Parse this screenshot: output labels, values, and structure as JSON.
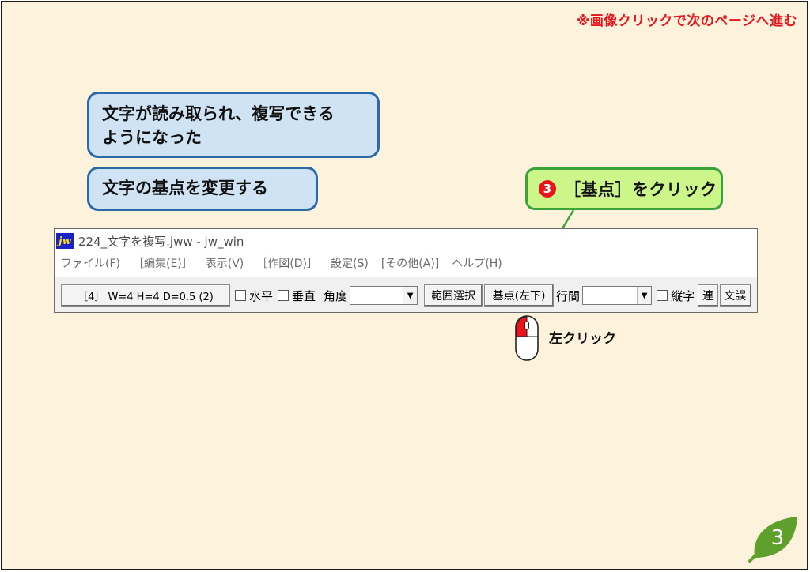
{
  "header": {
    "nav_hint": "※画像クリックで次のページへ進む"
  },
  "callouts": {
    "line1": "文字が読み取られ、複写できる",
    "line2": "ようになった",
    "sub": "文字の基点を変更する"
  },
  "step": {
    "number": "3",
    "label": "［基点］をクリック"
  },
  "window": {
    "title": "224_文字を複写.jww - jw_win",
    "menus": [
      "ファイル(F)",
      "［編集(E)］",
      "表示(V)",
      "［作図(D)］",
      "設定(S)",
      "[その他(A)]",
      "ヘルプ(H)"
    ],
    "toolbar": {
      "status_button": "［4］ W=4 H=4 D=0.5 (2)",
      "horizontal_label": "水平",
      "vertical_label": "垂直",
      "angle_label": "角度",
      "angle_value": "",
      "range_select_button": "範囲選択",
      "base_point_button": "基点(左下)",
      "line_spacing_label": "行間",
      "line_spacing_value": "",
      "vertical_text_label": "縦字",
      "continuous_button": "連",
      "text_partial_button": "文誤"
    }
  },
  "mouse": {
    "label": "左クリック",
    "highlight_color": "#e8141c"
  },
  "page_number": "3",
  "colors": {
    "callout_blue": "#cfe3f5",
    "callout_green": "#ccf58a",
    "accent_red": "#e8141c",
    "leaf_green": "#5fa02c"
  }
}
